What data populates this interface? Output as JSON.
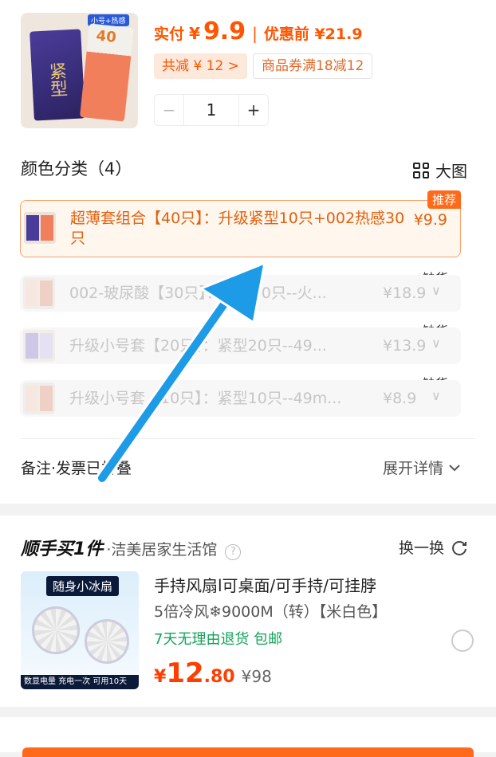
{
  "order": {
    "price_label": "实付",
    "currency": "¥",
    "price": "9.9",
    "separator": "|",
    "price_before": "优惠前 ¥21.9",
    "discount_tag": "共减 ¥ 12 >",
    "coupon_tag": "商品券满18减12",
    "quantity": "1",
    "minus": "−",
    "plus": "+",
    "thumb_badge": "小号+热感",
    "thumb_text": "紧型",
    "thumb_num": "40"
  },
  "variants": {
    "title": "颜色分类（4）",
    "big_view": "大图",
    "recommend_badge": "推荐",
    "soldout_label": "缺货",
    "items": [
      {
        "name": "超薄套组合【40只】：升级紧型10只+002热感30只",
        "price": "¥9.9"
      },
      {
        "name": "002-玻尿酸【30只】：热感30只--火...",
        "price": "¥18.9"
      },
      {
        "name": "升级小号套【20只】：紧型20只--49...",
        "price": "¥13.9"
      },
      {
        "name": "升级小号套【10只】：紧型10只--49m...",
        "price": "¥8.9"
      }
    ],
    "chevron": "∨"
  },
  "remark": {
    "label": "备注·发票已折叠",
    "expand": "展开详情"
  },
  "addon": {
    "title": "顺手买1件",
    "shop": "·洁美居家生活馆",
    "help": "?",
    "swap": "换一换",
    "product_name": "手持风扇l可桌面/可手持/可挂脖",
    "spec": "5倍冷风❄9000M（转）【米白色】",
    "service": "7天无理由退货  包邮",
    "price_yen": "¥",
    "price_int": "12",
    "price_dec": ".80",
    "price_orig": "¥98",
    "thumb_title": "随身小冰扇",
    "thumb_footer": "数显电量  充电一次 可用10天"
  },
  "colors": {
    "accent": "#ff5500",
    "green": "#12a35a",
    "arrow": "#1e9be6"
  }
}
